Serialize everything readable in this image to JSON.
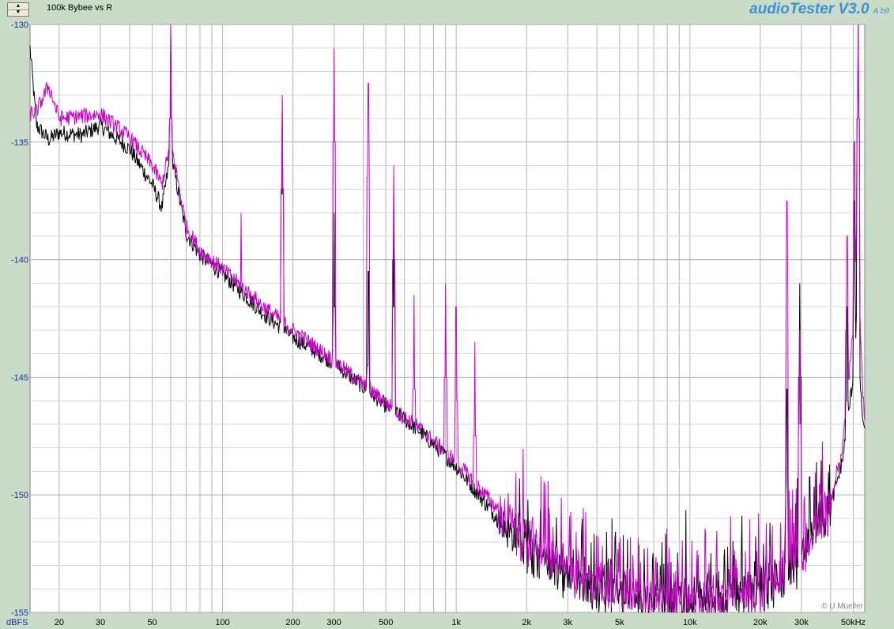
{
  "window": {
    "title": "100k Bybee vs R",
    "brand": "audioTester V3.0",
    "brand_version": "A b9",
    "copyright": "© U.Mueller",
    "colors": {
      "background": "#c8dcc8",
      "plot_bg": "#ffffff",
      "grid": "#b4b4b4",
      "series_a": "#000000",
      "series_b": "#cc00cc",
      "brand": "#3d8fd8"
    }
  },
  "chart_data": {
    "type": "line",
    "title": "100k Bybee vs R",
    "xlabel": "",
    "ylabel": "dBFS",
    "x_scale": "log",
    "xlim": [
      15,
      56000
    ],
    "ylim": [
      -155,
      -130
    ],
    "grid": true,
    "y_ticks": [
      "-130",
      "-135",
      "-140",
      "-145",
      "-150",
      "-155"
    ],
    "y_unit_label": "dBFS",
    "x_ticks": [
      {
        "v": 20,
        "label": "20"
      },
      {
        "v": 30,
        "label": "30"
      },
      {
        "v": 50,
        "label": "50"
      },
      {
        "v": 100,
        "label": "100"
      },
      {
        "v": 200,
        "label": "200"
      },
      {
        "v": 300,
        "label": "300"
      },
      {
        "v": 500,
        "label": "500"
      },
      {
        "v": 1000,
        "label": "1k"
      },
      {
        "v": 2000,
        "label": "2k"
      },
      {
        "v": 3000,
        "label": "3k"
      },
      {
        "v": 5000,
        "label": "5k"
      },
      {
        "v": 10000,
        "label": "10k"
      },
      {
        "v": 20000,
        "label": "20k"
      },
      {
        "v": 30000,
        "label": "30k"
      },
      {
        "v": 50000,
        "label": "50kHz"
      }
    ],
    "series": [
      {
        "color": "#000000",
        "points": [
          [
            15,
            -131
          ],
          [
            16,
            -134.3
          ],
          [
            18,
            -134.9
          ],
          [
            20,
            -134.6
          ],
          [
            25,
            -134.7
          ],
          [
            30,
            -134.3
          ],
          [
            40,
            -135.3
          ],
          [
            50,
            -136.8
          ],
          [
            55,
            -137.8
          ],
          [
            60,
            -135.5
          ],
          [
            70,
            -138.9
          ],
          [
            80,
            -139.8
          ],
          [
            100,
            -140.6
          ],
          [
            150,
            -142.3
          ],
          [
            200,
            -143.3
          ],
          [
            300,
            -144.4
          ],
          [
            500,
            -146.2
          ],
          [
            700,
            -147.3
          ],
          [
            1000,
            -148.8
          ],
          [
            1500,
            -151
          ],
          [
            2000,
            -152.3
          ],
          [
            3000,
            -153.4
          ],
          [
            5000,
            -154.3
          ],
          [
            7000,
            -154.6
          ],
          [
            10000,
            -154.5
          ],
          [
            15000,
            -154.2
          ],
          [
            20000,
            -153.9
          ],
          [
            25000,
            -153.3
          ],
          [
            30000,
            -152.5
          ],
          [
            40000,
            -150.5
          ],
          [
            45000,
            -148.5
          ],
          [
            50000,
            -145
          ],
          [
            52000,
            -142
          ],
          [
            54000,
            -146
          ],
          [
            56000,
            -147.5
          ]
        ],
        "spikes": [
          [
            60,
            -130
          ],
          [
            120,
            -141.8
          ],
          [
            180,
            -133.2
          ],
          [
            300,
            -138
          ],
          [
            420,
            -140.5
          ],
          [
            540,
            -138
          ],
          [
            26000,
            -145.5
          ],
          [
            29500,
            -141
          ],
          [
            47000,
            -142
          ],
          [
            50500,
            -137.5
          ],
          [
            52500,
            -130
          ]
        ]
      },
      {
        "color": "#cc00cc",
        "points": [
          [
            15,
            -133.8
          ],
          [
            16,
            -133.7
          ],
          [
            18,
            -132.6
          ],
          [
            20,
            -134
          ],
          [
            25,
            -133.9
          ],
          [
            30,
            -133.8
          ],
          [
            40,
            -134.8
          ],
          [
            50,
            -136
          ],
          [
            55,
            -136.8
          ],
          [
            60,
            -135
          ],
          [
            70,
            -138.6
          ],
          [
            80,
            -139.6
          ],
          [
            100,
            -140.4
          ],
          [
            150,
            -142
          ],
          [
            200,
            -143
          ],
          [
            300,
            -144.3
          ],
          [
            500,
            -146.1
          ],
          [
            700,
            -147.2
          ],
          [
            1000,
            -148.6
          ],
          [
            1500,
            -150.6
          ],
          [
            2000,
            -152
          ],
          [
            3000,
            -153.3
          ],
          [
            5000,
            -154.2
          ],
          [
            7000,
            -154.6
          ],
          [
            10000,
            -154.6
          ],
          [
            15000,
            -154.4
          ],
          [
            20000,
            -154
          ],
          [
            25000,
            -153.4
          ],
          [
            30000,
            -152.6
          ],
          [
            40000,
            -150.2
          ],
          [
            45000,
            -148
          ],
          [
            50000,
            -143
          ],
          [
            52000,
            -138
          ],
          [
            54000,
            -144
          ],
          [
            56000,
            -147
          ]
        ],
        "spikes": [
          [
            60,
            -130
          ],
          [
            120,
            -138
          ],
          [
            180,
            -133
          ],
          [
            300,
            -131
          ],
          [
            420,
            -132.5
          ],
          [
            540,
            -136
          ],
          [
            660,
            -141.5
          ],
          [
            900,
            -141
          ],
          [
            1000,
            -142
          ],
          [
            1200,
            -143.5
          ],
          [
            26000,
            -137.5
          ],
          [
            29500,
            -143
          ],
          [
            47000,
            -139
          ],
          [
            50500,
            -135
          ],
          [
            52500,
            -130
          ]
        ]
      }
    ]
  }
}
